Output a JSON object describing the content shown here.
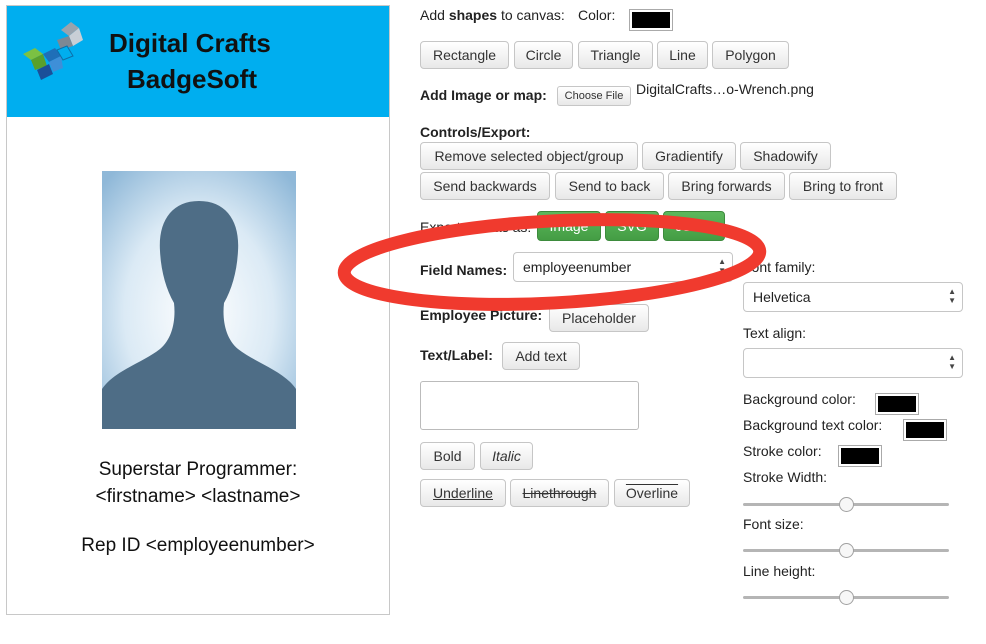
{
  "badge": {
    "brand_line1": "Digital Crafts",
    "brand_line2": "BadgeSoft",
    "title_line": "Superstar Programmer:",
    "name_line": "<firstname> <lastname>",
    "id_line": "Rep ID <employeenumber>",
    "header_color": "#00aeef"
  },
  "controls": {
    "shapes_prefix": "Add ",
    "shapes_bold": "shapes",
    "shapes_suffix": " to canvas:",
    "color_label": "Color:",
    "shape_buttons": [
      "Rectangle",
      "Circle",
      "Triangle",
      "Line",
      "Polygon"
    ],
    "add_image_label": "Add Image or map:",
    "choose_file": "Choose File",
    "file_name": "DigitalCrafts…o-Wrench.png",
    "controls_export_label": "Controls/Export:",
    "remove_btn": "Remove selected object/group",
    "gradientify_btn": "Gradientify",
    "shadowify_btn": "Shadowify",
    "send_backwards_btn": "Send backwards",
    "send_to_back_btn": "Send to back",
    "bring_forwards_btn": "Bring forwards",
    "bring_to_front_btn": "Bring to front",
    "export_label": "Export canvas as:",
    "export_image_btn": "Image",
    "export_svg_btn": "SVG",
    "export_json_btn": "JSON",
    "field_names_label": "Field Names:",
    "field_names_value": "employeenumber",
    "employee_picture_label": "Employee Picture:",
    "placeholder_btn": "Placeholder",
    "text_label_label": "Text/Label:",
    "add_text_btn": "Add text",
    "bold_btn": "Bold",
    "italic_btn": "Italic",
    "underline_btn": "Underline",
    "linethrough_btn": "Linethrough",
    "overline_btn": "Overline"
  },
  "properties": {
    "font_family_label": "Font family:",
    "font_family_value": "Helvetica",
    "text_align_label": "Text align:",
    "text_align_value": "",
    "bg_color_label": "Background color:",
    "bg_text_color_label": "Background text color:",
    "stroke_color_label": "Stroke color:",
    "stroke_width_label": "Stroke Width:",
    "font_size_label": "Font size:",
    "line_height_label": "Line height:",
    "stroke_width_level": 0.5,
    "font_size_level": 0.5,
    "line_height_level": 0.5
  },
  "annotation": {
    "color": "#f03a2e"
  }
}
